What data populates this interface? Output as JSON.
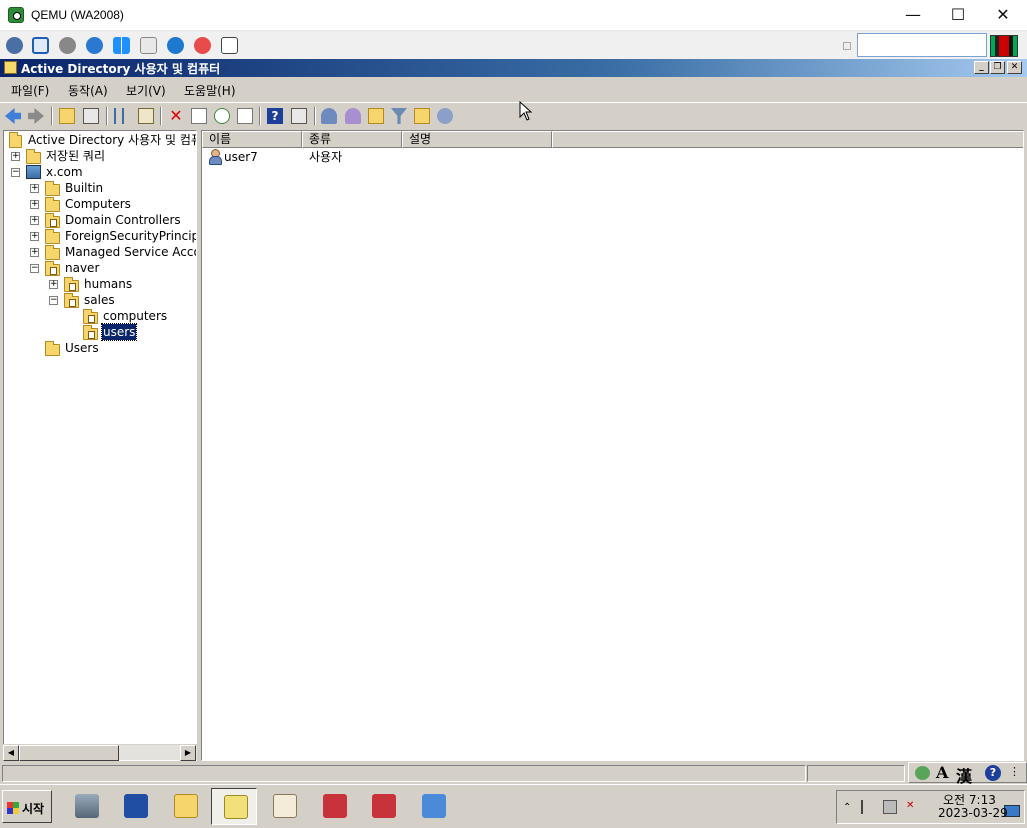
{
  "qemu": {
    "title": "QEMU (WA2008)",
    "controls": {
      "minimize": "—",
      "maximize": "☐",
      "close": "✕"
    }
  },
  "mmc": {
    "title": "Active Directory 사용자 및 컴퓨터",
    "controls": {
      "minimize": "_",
      "restore": "❐",
      "close": "✕"
    }
  },
  "menu": [
    "파일(F)",
    "동작(A)",
    "보기(V)",
    "도움말(H)"
  ],
  "tree": {
    "root_label": "Active Directory 사용자 및 컴퓨",
    "saved_queries": "저장된 쿼리",
    "domain": "x.com",
    "containers": [
      "Builtin",
      "Computers",
      "Domain Controllers",
      "ForeignSecurityPrincipa",
      "Managed Service Acco"
    ],
    "ou_naver": "naver",
    "ou_humans": "humans",
    "ou_sales": "sales",
    "ou_computers": "computers",
    "ou_users": "users",
    "users_container": "Users",
    "expander_plus": "+",
    "expander_minus": "−"
  },
  "list": {
    "columns": [
      "이름",
      "종류",
      "설명"
    ],
    "rows": [
      {
        "name": "user7",
        "type": "사용자",
        "description": ""
      }
    ]
  },
  "ime": {
    "mode": "A",
    "hanja": "漢",
    "help": "?"
  },
  "taskbar": {
    "start_label": "시작",
    "clock_time": "오전 7:13",
    "clock_date": "2023-03-29"
  },
  "colors": {
    "titlebar": "#0a246a",
    "selection": "#0a246a",
    "chrome": "#d4d0c8"
  }
}
